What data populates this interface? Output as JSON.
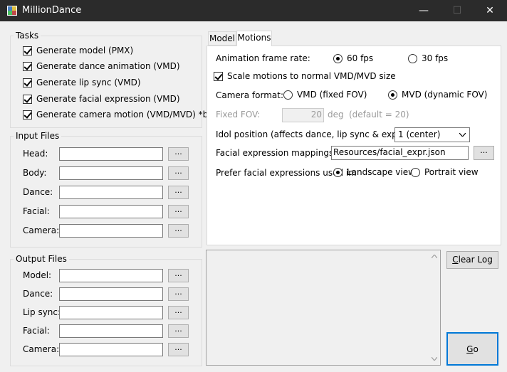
{
  "window": {
    "title": "MillionDance",
    "minimize": "—",
    "maximize": "☐",
    "close": "✕"
  },
  "tasks": {
    "label": "Tasks",
    "items": [
      {
        "label": "Generate model (PMX)",
        "checked": true
      },
      {
        "label": "Generate dance animation (VMD)",
        "checked": true
      },
      {
        "label": "Generate lip sync (VMD)",
        "checked": true
      },
      {
        "label": "Generate facial expression (VMD)",
        "checked": true
      },
      {
        "label": "Generate camera motion (VMD/MVD) *buggy",
        "checked": true
      }
    ]
  },
  "input_files": {
    "label": "Input Files",
    "rows": [
      {
        "label": "Head:",
        "value": ""
      },
      {
        "label": "Body:",
        "value": ""
      },
      {
        "label": "Dance:",
        "value": ""
      },
      {
        "label": "Facial:",
        "value": ""
      },
      {
        "label": "Camera:",
        "value": ""
      }
    ],
    "browse": "..."
  },
  "output_files": {
    "label": "Output Files",
    "rows": [
      {
        "label": "Model:",
        "value": ""
      },
      {
        "label": "Dance:",
        "value": ""
      },
      {
        "label": "Lip sync:",
        "value": ""
      },
      {
        "label": "Facial:",
        "value": ""
      },
      {
        "label": "Camera:",
        "value": ""
      }
    ],
    "browse": "..."
  },
  "tabs": [
    {
      "label": "Model",
      "active": false
    },
    {
      "label": "Motions",
      "active": true
    }
  ],
  "motions": {
    "frame_rate_label": "Animation frame rate:",
    "fps60": "60 fps",
    "fps30": "30 fps",
    "scale_motions": "Scale motions to normal VMD/MVD size",
    "camera_format_label": "Camera format:",
    "vmd_option": "VMD (fixed FOV)",
    "mvd_option": "MVD (dynamic FOV)",
    "fixed_fov_label": "Fixed FOV:",
    "fixed_fov_value": "20",
    "fov_unit": "deg",
    "fov_default": "(default = 20)",
    "idol_position_label": "Idol position (affects dance, lip sync & expression):",
    "idol_position_value": "1 (center)",
    "facial_mappings_label": "Facial expression mappings:",
    "facial_mappings_value": "Resources/facial_expr.json",
    "browse": "...",
    "prefer_label": "Prefer facial expressions used in:",
    "landscape": "Landscape view",
    "portrait": "Portrait view"
  },
  "log": {
    "text": ""
  },
  "buttons": {
    "clear_log_first": "C",
    "clear_log_rest": "lear Log",
    "go_first": "G",
    "go_rest": "o"
  }
}
